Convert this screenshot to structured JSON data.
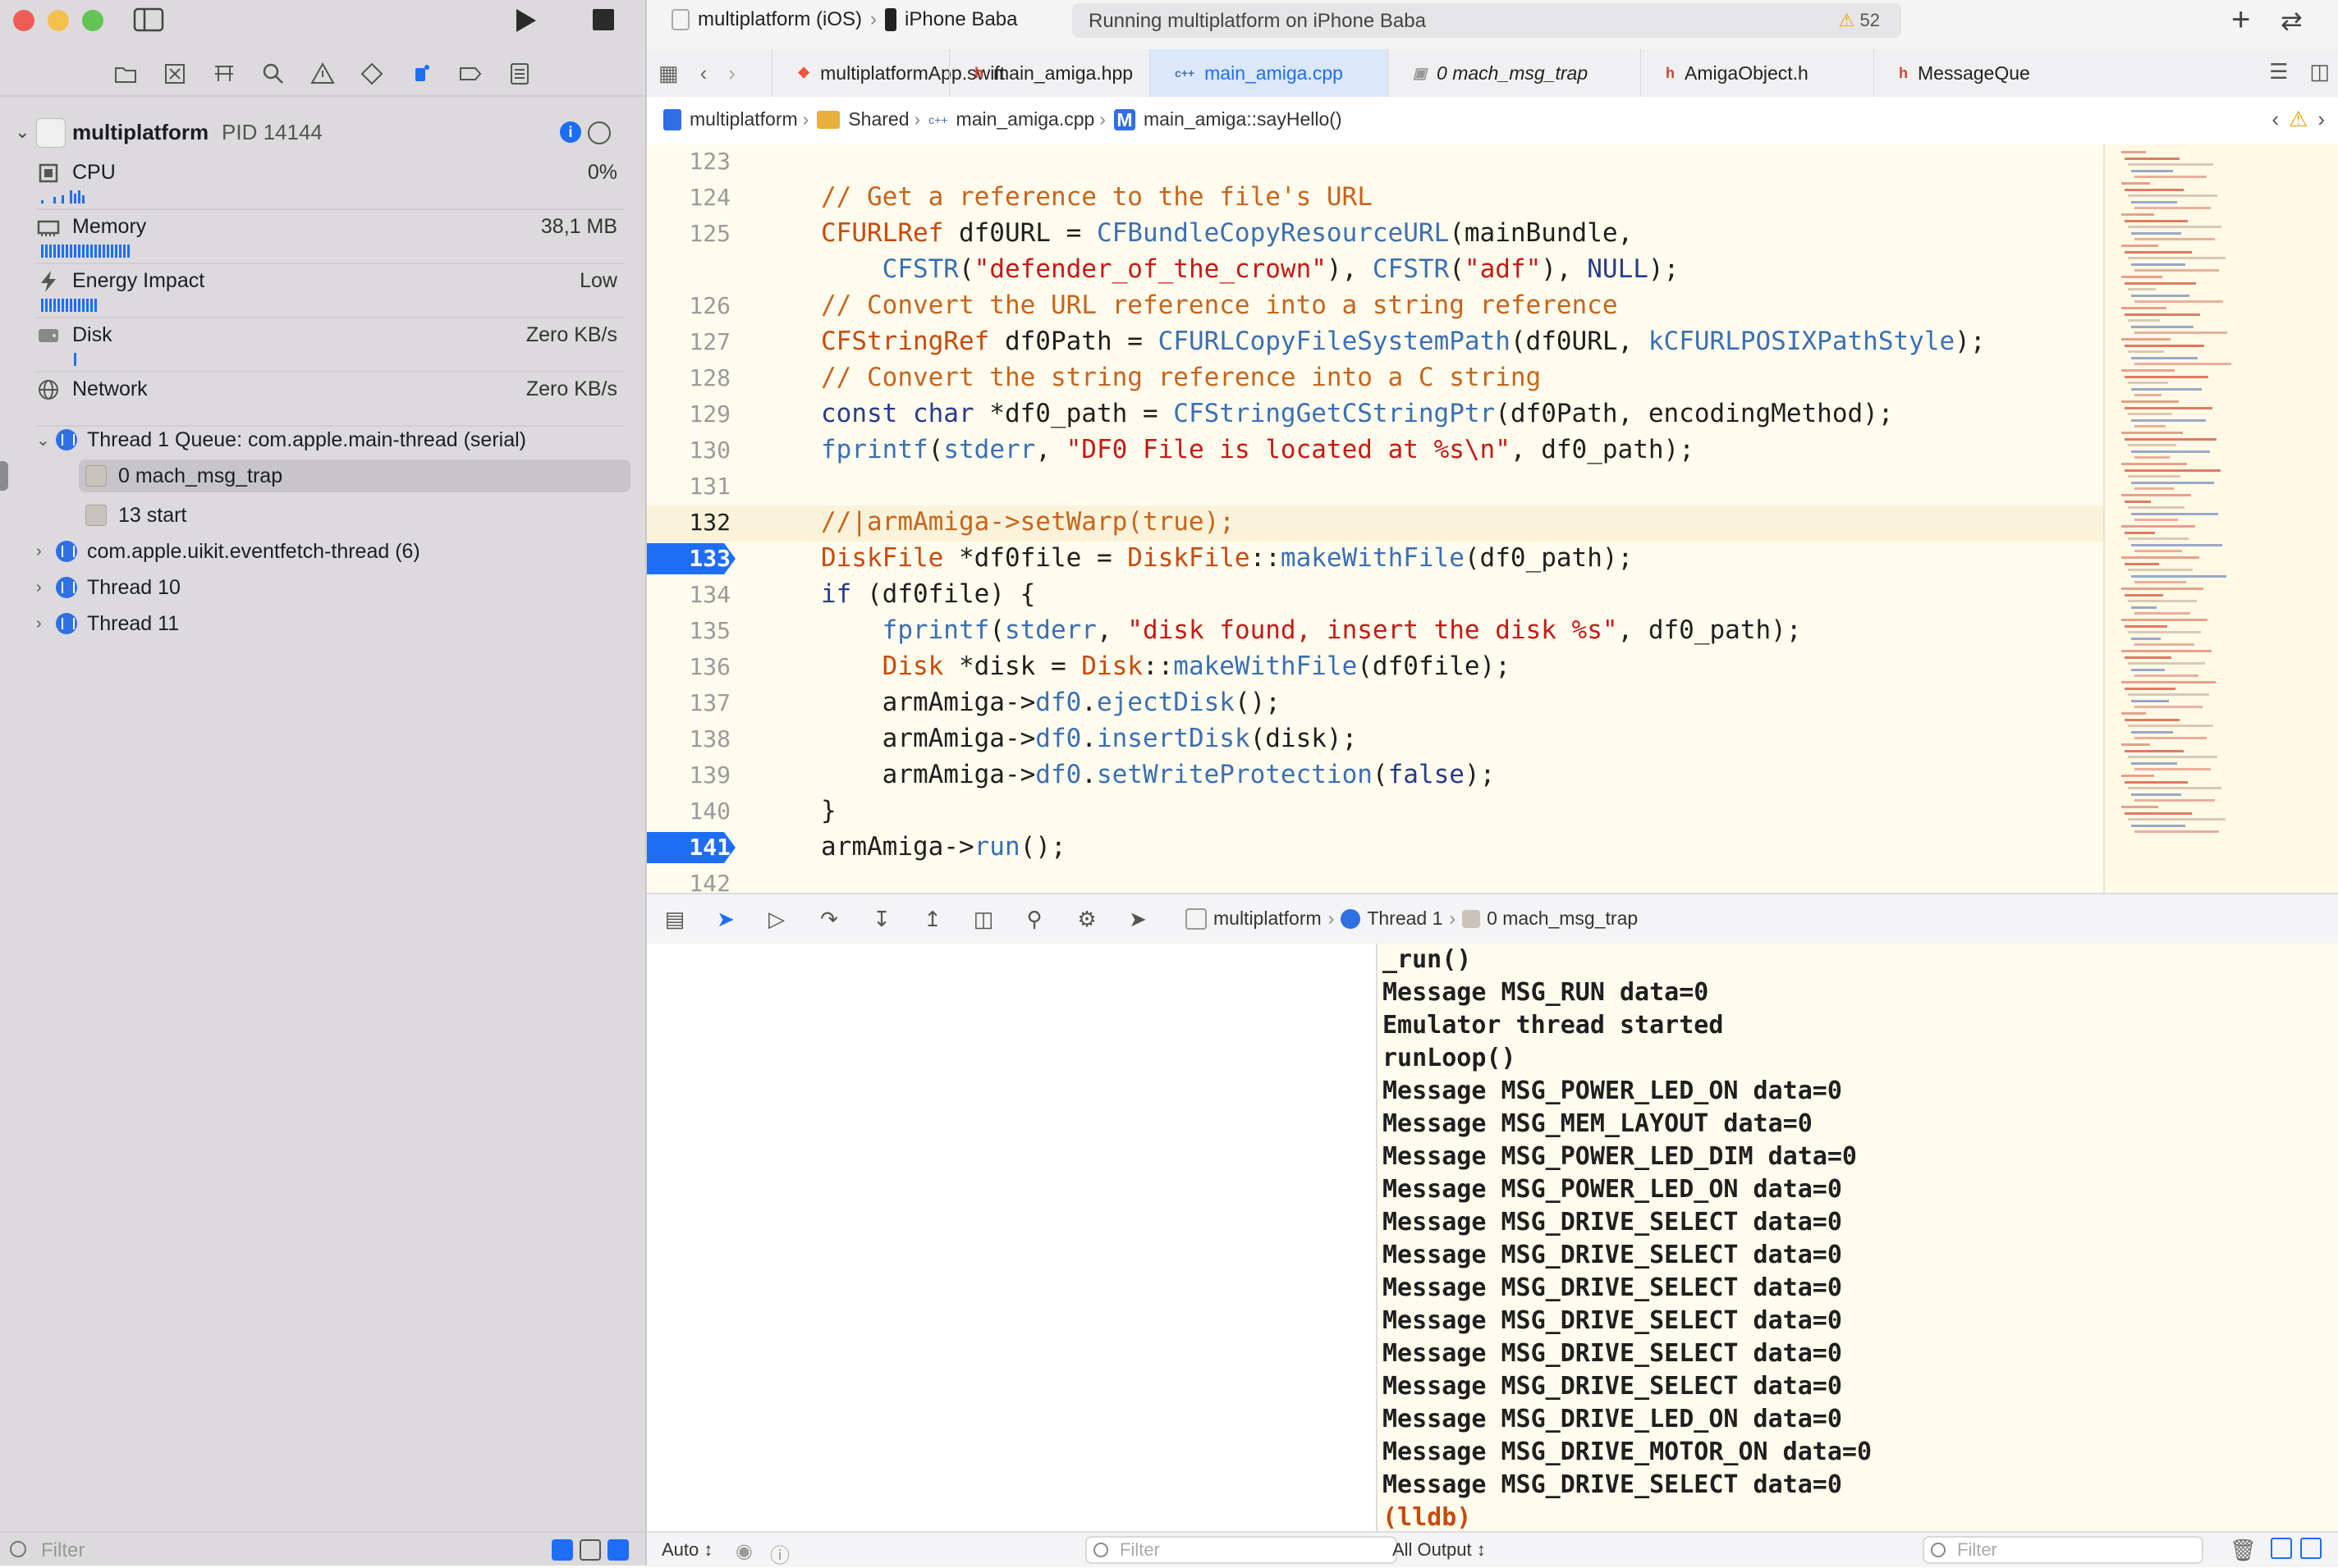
{
  "window": {
    "run_label": "Run",
    "stop_label": "Stop"
  },
  "toolbar": {
    "scheme": "multiplatform (iOS)",
    "device": "iPhone Baba",
    "activity": "Running multiplatform on iPhone Baba",
    "warning_count": "52"
  },
  "navigator": {
    "process_name": "multiplatform",
    "process_pid": "PID 14144",
    "gauges": [
      {
        "label": "CPU",
        "value": "0%"
      },
      {
        "label": "Memory",
        "value": "38,1 MB"
      },
      {
        "label": "Energy Impact",
        "value": "Low"
      },
      {
        "label": "Disk",
        "value": "Zero KB/s"
      },
      {
        "label": "Network",
        "value": "Zero KB/s"
      }
    ],
    "thread1": "Thread 1 Queue: com.apple.main-thread (serial)",
    "frames": [
      "0 mach_msg_trap",
      "13 start"
    ],
    "threads": [
      "com.apple.uikit.eventfetch-thread (6)",
      "Thread 10",
      "Thread 11"
    ],
    "filter_placeholder": "Filter"
  },
  "tabs": [
    {
      "label": "multiplatformApp.swift",
      "icon": "swift-icon"
    },
    {
      "label": "main_amiga.hpp",
      "icon": "h"
    },
    {
      "label": "main_amiga.cpp",
      "icon": "cpp"
    },
    {
      "label": "0 mach_msg_trap",
      "icon": "frame"
    },
    {
      "label": "AmigaObject.h",
      "icon": "h"
    },
    {
      "label": "MessageQue",
      "icon": "h"
    }
  ],
  "jumpbar": {
    "project": "multiplatform",
    "group": "Shared",
    "file": "main_amiga.cpp",
    "method_badge": "M",
    "method": "main_amiga::sayHello()"
  },
  "editor": {
    "line_numbers": [
      "123",
      "124",
      "125",
      "",
      "126",
      "127",
      "128",
      "129",
      "130",
      "131",
      "132",
      "133",
      "134",
      "135",
      "136",
      "137",
      "138",
      "139",
      "140",
      "141",
      "142"
    ],
    "breakpoint_lines": [
      "133",
      "141"
    ],
    "current_line": "132"
  },
  "debugbar": {
    "process": "multiplatform",
    "thread": "Thread 1",
    "frame": "0 mach_msg_trap"
  },
  "console": {
    "lines": [
      "_run()",
      "Message MSG_RUN data=0",
      "Emulator thread started",
      "runLoop()",
      "Message MSG_POWER_LED_ON data=0",
      "Message MSG_MEM_LAYOUT data=0",
      "Message MSG_POWER_LED_DIM data=0",
      "Message MSG_POWER_LED_ON data=0",
      "Message MSG_DRIVE_SELECT data=0",
      "Message MSG_DRIVE_SELECT data=0",
      "Message MSG_DRIVE_SELECT data=0",
      "Message MSG_DRIVE_SELECT data=0",
      "Message MSG_DRIVE_SELECT data=0",
      "Message MSG_DRIVE_SELECT data=0",
      "Message MSG_DRIVE_LED_ON data=0",
      "Message MSG_DRIVE_MOTOR_ON data=0",
      "Message MSG_DRIVE_SELECT data=0"
    ],
    "prompt": "(lldb)"
  },
  "bottom": {
    "auto_label": "Auto ↕",
    "filter_placeholder": "Filter",
    "output_label": "All Output ↕"
  }
}
